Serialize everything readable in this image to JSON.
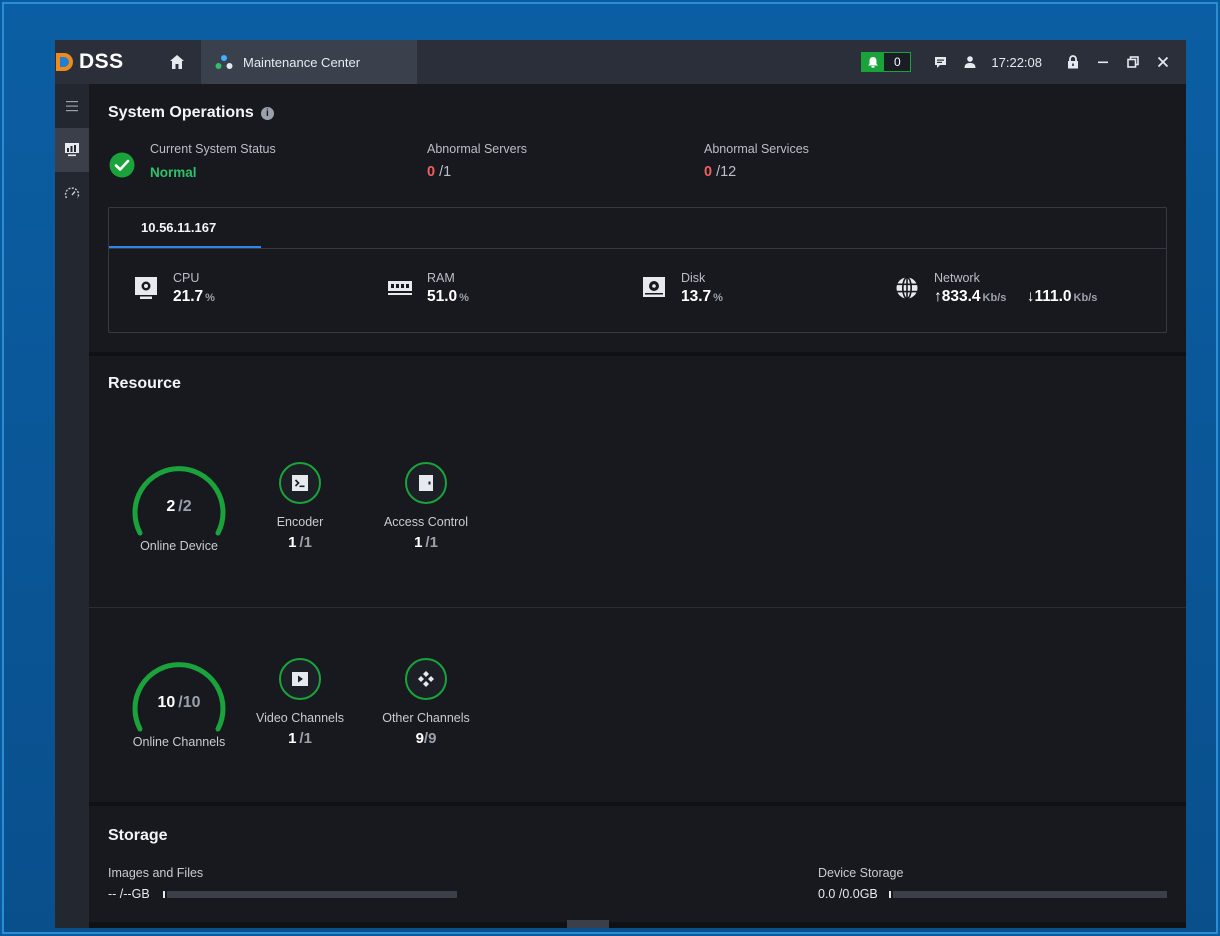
{
  "app": {
    "name": "DSS",
    "tab_label": "Maintenance Center",
    "alarm_count": "0",
    "clock": "17:22:08"
  },
  "system": {
    "title": "System Operations",
    "info_glyph": "i",
    "status_label": "Current System Status",
    "status_value": "Normal",
    "abn_servers_label": "Abnormal Servers",
    "abn_servers_count": "0",
    "abn_servers_total": "/1",
    "abn_services_label": "Abnormal Services",
    "abn_services_count": "0",
    "abn_services_total": "/12"
  },
  "server": {
    "ip": "10.56.11.167",
    "cpu_label": "CPU",
    "cpu_value": "21.7",
    "cpu_unit": "%",
    "ram_label": "RAM",
    "ram_value": "51.0",
    "ram_unit": "%",
    "disk_label": "Disk",
    "disk_value": "13.7",
    "disk_unit": "%",
    "net_label": "Network",
    "net_up": "↑833.4",
    "net_up_unit": "Kb/s",
    "net_down": "↓111.0",
    "net_down_unit": "Kb/s"
  },
  "resource": {
    "title": "Resource",
    "device": {
      "online": "2",
      "total": "/2",
      "label": "Online Device",
      "fraction": 1.0,
      "encoder_label": "Encoder",
      "encoder_value": "1",
      "encoder_total": "/1",
      "access_label": "Access Control",
      "access_value": "1",
      "access_total": "/1"
    },
    "channels": {
      "online": "10",
      "total": "/10",
      "label": "Online Channels",
      "fraction": 1.0,
      "video_label": "Video Channels",
      "video_value": "1",
      "video_total": "/1",
      "other_label": "Other Channels",
      "other_value": "9",
      "other_total": "/9"
    }
  },
  "storage": {
    "title": "Storage",
    "images_label": "Images and Files",
    "images_value": "-- /--GB",
    "device_label": "Device Storage",
    "device_value": "0.0 /0.0GB"
  },
  "colors": {
    "accent_green": "#1aa33a",
    "accent_blue": "#2e87e6",
    "alert_red": "#ef5f5f",
    "status_ok": "#2ec16a"
  }
}
